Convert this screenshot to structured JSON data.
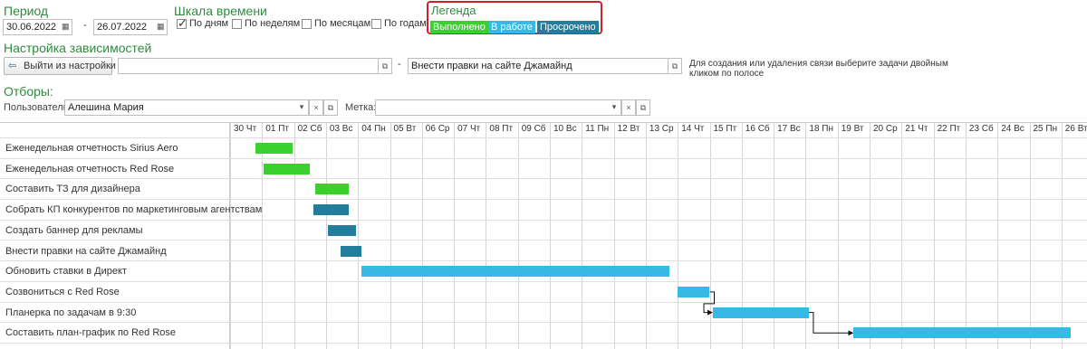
{
  "period": {
    "title": "Период",
    "from": "30.06.2022",
    "to": "26.07.2022",
    "sep": "-"
  },
  "timescale": {
    "title": "Шкала времени",
    "options": [
      {
        "label": "По дням",
        "checked": true
      },
      {
        "label": "По неделям",
        "checked": false
      },
      {
        "label": "По месяцам",
        "checked": false
      },
      {
        "label": "По годам",
        "checked": false
      }
    ]
  },
  "legend": {
    "title": "Легенда",
    "items": [
      {
        "label": "Выполнено",
        "color": "#3ad12f"
      },
      {
        "label": "В работе",
        "color": "#36b9e5"
      },
      {
        "label": "Просрочено",
        "color": "#237e9d"
      }
    ]
  },
  "deps": {
    "title": "Настройка зависимостей",
    "exit_button": "Выйти из настройки",
    "field1": "",
    "sep": "-",
    "field2": "Внести правки на сайте Джамайнд",
    "hint": "Для создания или удаления связи выберите задачи двойным кликом по полосе"
  },
  "filters": {
    "title": "Отборы:",
    "user_label": "Пользователь:",
    "user_value": "Алешина Мария",
    "tag_label": "Метка:",
    "tag_value": ""
  },
  "gantt": {
    "days": [
      "30 Чт",
      "01 Пт",
      "02 Сб",
      "03 Вс",
      "04 Пн",
      "05 Вт",
      "06 Ср",
      "07 Чт",
      "08 Пт",
      "09 Сб",
      "10 Вс",
      "11 Пн",
      "12 Вт",
      "13 Ср",
      "14 Чт",
      "15 Пт",
      "16 Сб",
      "17 Вс",
      "18 Пн",
      "19 Вт",
      "20 Ср",
      "21 Чт",
      "22 Пт",
      "23 Сб",
      "24 Вс",
      "25 Пн",
      "26 Вт"
    ],
    "tasks": [
      {
        "name": "Еженедельная отчетность Sirius Aero",
        "status": "done",
        "start": 0.8,
        "end": 1.95
      },
      {
        "name": "Еженедельная отчетность Red Rose",
        "status": "done",
        "start": 1.05,
        "end": 2.5
      },
      {
        "name": "Составить ТЗ для дизайнера",
        "status": "done",
        "start": 2.65,
        "end": 3.7
      },
      {
        "name": "Собрать КП конкурентов по маркетинговым агентствам",
        "status": "overdue",
        "start": 2.6,
        "end": 3.7
      },
      {
        "name": "Создать баннер для рекламы",
        "status": "overdue",
        "start": 3.05,
        "end": 3.95
      },
      {
        "name": "Внести правки на сайте Джамайнд",
        "status": "overdue",
        "start": 3.45,
        "end": 4.1
      },
      {
        "name": "Обновить ставки в Директ",
        "status": "in_progress",
        "start": 4.1,
        "end": 13.75
      },
      {
        "name": "Созвониться с Red Rose",
        "status": "in_progress",
        "start": 14.0,
        "end": 15.0
      },
      {
        "name": "Планерка по задачам в 9:30",
        "status": "in_progress",
        "start": 15.1,
        "end": 18.1
      },
      {
        "name": "Составить план-график по Red Rose",
        "status": "in_progress",
        "start": 19.5,
        "end": 26.3
      }
    ]
  }
}
